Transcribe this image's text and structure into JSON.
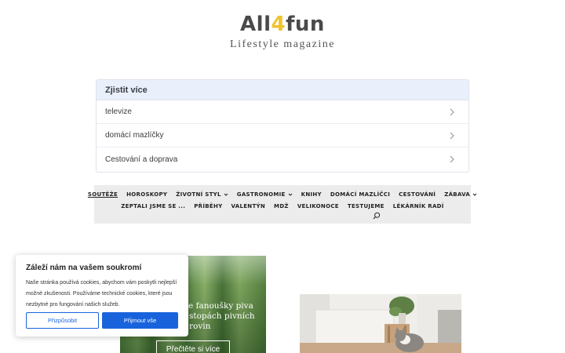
{
  "logo": {
    "part1": "All",
    "part2": "4",
    "part3": "fun",
    "tagline": "Lifestyle magazine"
  },
  "related": {
    "header": "Zjistit více",
    "items": [
      {
        "label": "televize"
      },
      {
        "label": "domácí mazlíčky"
      },
      {
        "label": "Cestování a doprava"
      }
    ]
  },
  "nav": {
    "row1": [
      "SOUTĚŽE",
      "HOROSKOPY",
      "ŽIVOTNÍ STYL",
      "GASTRONOMIE",
      "KNIHY",
      "DOMÁCÍ MAZLÍČCI",
      "CESTOVÁNÍ",
      "ZÁBAVA"
    ],
    "row2": [
      "ZEPTALI JSME SE ...",
      "PŘÍBĚHY",
      "VALENTÝN",
      "MDŽ",
      "VELIKONOCE",
      "TESTUJEME",
      "LÉKÁRNÍK RADÍ"
    ]
  },
  "card_green": {
    "text_line1": "re fanoušky piva",
    "text_line2": "stopách pivních",
    "text_line3": "rovin",
    "button": "Přečtěte si více"
  },
  "cookie": {
    "title": "Záleží nám na vašem soukromí",
    "text": "Naše stránka používá cookies, abychom vám poskytli nejlepší možné zkušenosti. Používáme technické cookies, které jsou nezbytné pro fungování našich služeb.",
    "customize": "Přizpůsobit",
    "accept": "Přijmout vše"
  },
  "colors": {
    "accent": "#1863dc",
    "logo_four": "#f2c230",
    "related_header_bg": "#e9effb"
  }
}
